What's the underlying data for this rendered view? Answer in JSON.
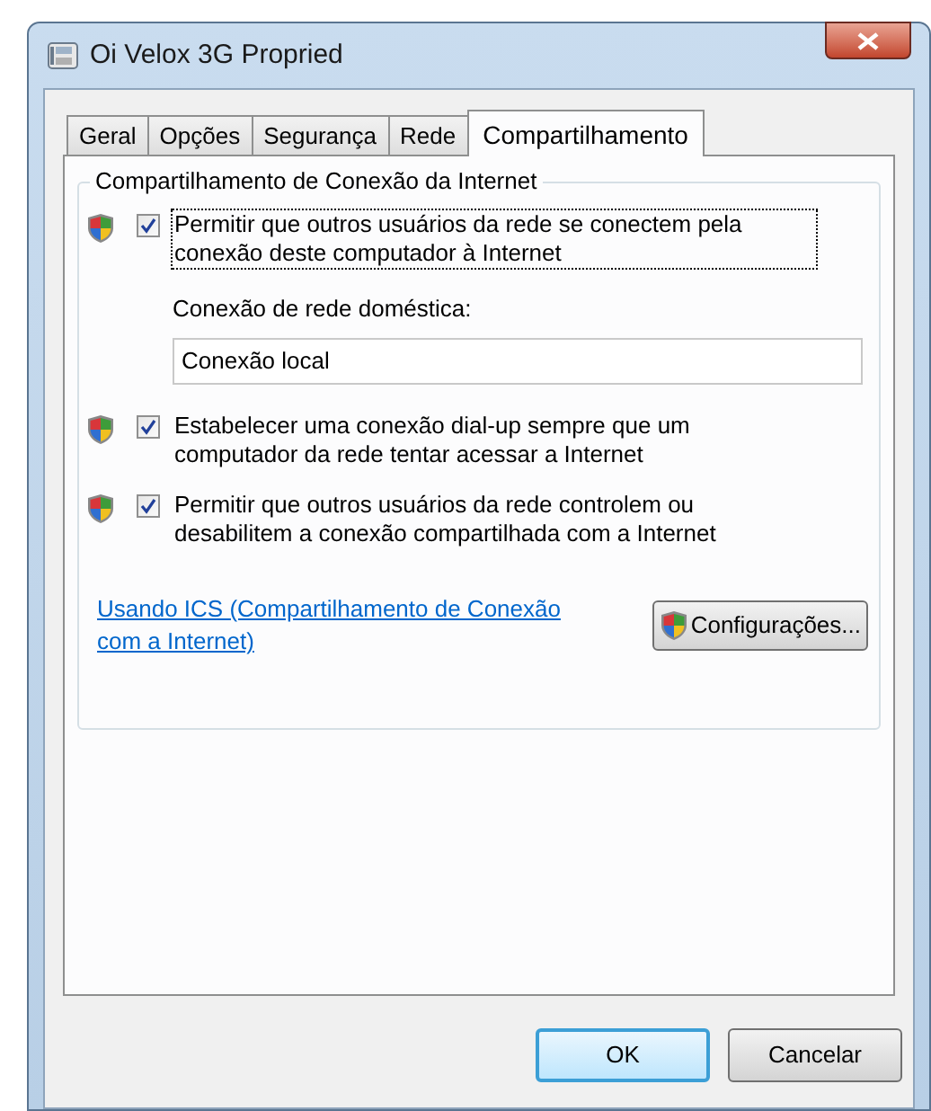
{
  "window": {
    "title": "Oi Velox 3G Propried"
  },
  "tabs": [
    {
      "label": "Geral",
      "selected": false
    },
    {
      "label": "Opções",
      "selected": false
    },
    {
      "label": "Segurança",
      "selected": false
    },
    {
      "label": "Rede",
      "selected": false
    },
    {
      "label": "Compartilhamento",
      "selected": true
    }
  ],
  "group": {
    "title": "Compartilhamento de Conexão da Internet",
    "items": [
      {
        "kind": "checkbox",
        "label": "Permitir que outros usuários da rede se conectem pela conexão deste computador à Internet",
        "checked": true,
        "focused": true
      },
      {
        "kind": "field",
        "label": "Conexão de rede doméstica:",
        "value": "Conexão local"
      },
      {
        "kind": "checkbox",
        "label": "Estabelecer uma conexão dial-up sempre que um computador da rede tentar acessar a Internet",
        "checked": true,
        "focused": false
      },
      {
        "kind": "checkbox",
        "label": "Permitir que outros usuários da rede controlem ou desabilitem a conexão compartilhada com a Internet",
        "checked": true,
        "focused": false
      }
    ],
    "link": "Usando ICS (Compartilhamento de Conexão com a Internet)",
    "settings_button": "Configurações..."
  },
  "buttons": [
    {
      "label": "OK",
      "default": true
    },
    {
      "label": "Cancelar",
      "default": false
    }
  ]
}
